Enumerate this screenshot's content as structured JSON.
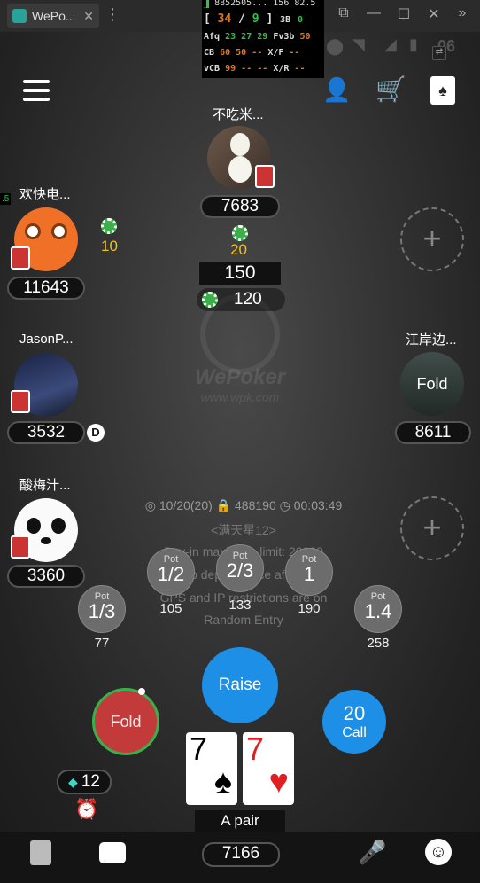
{
  "window": {
    "tab_title": "WePo..."
  },
  "hud": {
    "row1": "8852505...   156  82.5",
    "vpip": "34",
    "pfr": "9",
    "sep": "/",
    "tb_label": "3B",
    "tb_val": "0",
    "afq_label": "Afq",
    "afq_a": "23",
    "afq_b": "27",
    "afq_c": "29",
    "fv3b_label": "Fv3b",
    "fv3b_val": "50",
    "cb_label": "CB",
    "cb_a": "60",
    "cb_b": "50",
    "cb_c": "--",
    "xf_label": "X/F",
    "xf_val": "--",
    "vcb_label": "vCB",
    "vcb_a": "99",
    "vcb_b": "--",
    "vcb_c": "--",
    "xr_label": "X/R",
    "xr_val": "--",
    "side_val": ".5"
  },
  "status_time": "06",
  "players": {
    "top": {
      "name": "不吃米...",
      "stack": "7683",
      "bet": "20"
    },
    "left1": {
      "name": "欢快电...",
      "stack": "11643",
      "bet": "10"
    },
    "left2": {
      "name": "JasonP...",
      "stack": "3532",
      "dealer": "D"
    },
    "left3": {
      "name": "酸梅汁...",
      "stack": "3360"
    },
    "right2": {
      "name": "江岸边...",
      "stack": "8611",
      "status": "Fold"
    }
  },
  "pot": {
    "main": "150",
    "sub": "120"
  },
  "table_info": {
    "blinds": "10/20(20)",
    "id": "488190",
    "time": "00:03:49",
    "name": "<满天星12>",
    "line1": "Buy-in maximum limit: 20000",
    "line2": "Able to deposit once after all in",
    "line3": "GPS and IP restrictions are on",
    "line4": "Random Entry"
  },
  "pot_buttons": [
    {
      "label": "Pot",
      "frac": "1/3",
      "amount": "77"
    },
    {
      "label": "Pot",
      "frac": "1/2",
      "amount": "105"
    },
    {
      "label": "Pot",
      "frac": "2/3",
      "amount": "133"
    },
    {
      "label": "Pot",
      "frac": "1",
      "amount": "190"
    },
    {
      "label": "Pot",
      "frac": "1.4",
      "amount": "258"
    }
  ],
  "actions": {
    "raise": "Raise",
    "call_amount": "20",
    "call": "Call",
    "fold": "Fold"
  },
  "hole_cards": [
    {
      "rank": "7",
      "suit": "♠"
    },
    {
      "rank": "7",
      "suit": "♥"
    }
  ],
  "hand_label": "A pair",
  "gems": "12",
  "my_stack": "7166",
  "add_seat": "+",
  "watermark": {
    "brand": "WePoker",
    "url": "www.wpk.com"
  },
  "colors": {
    "accent_blue": "#1e8fe6",
    "fold_red": "#c23a3a",
    "chip_green": "#3bb04a",
    "bet_yellow": "#f2c21b"
  }
}
